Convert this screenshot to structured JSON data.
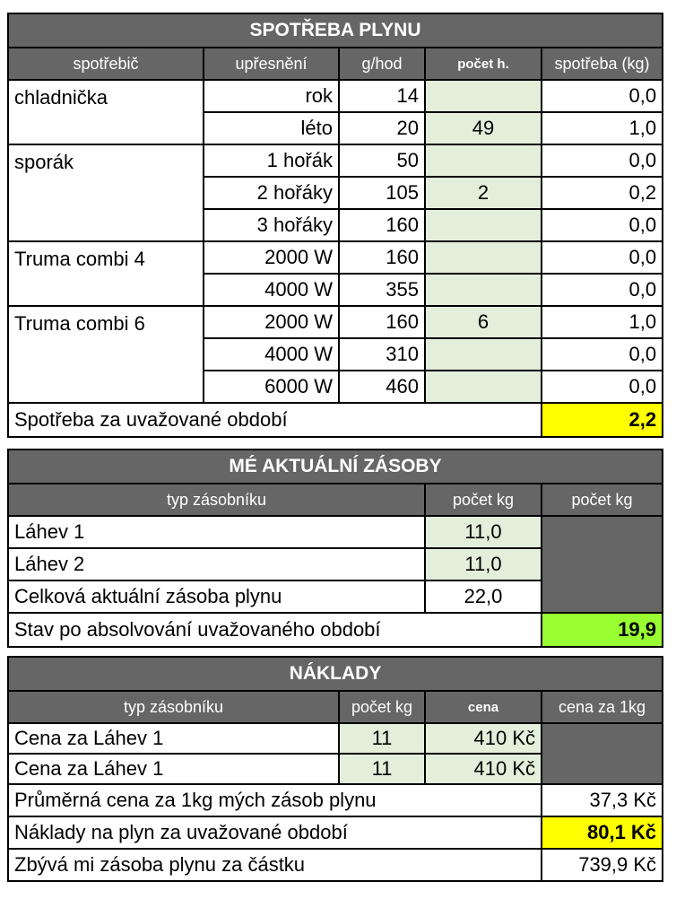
{
  "consumption": {
    "title": "SPOTŘEBA PLYNU",
    "headers": [
      "spotřebič",
      "upřesnění",
      "g/hod",
      "počet h.",
      "spotřeba (kg)"
    ],
    "groups": [
      {
        "appliance": "chladnička",
        "rows": [
          {
            "spec": "rok",
            "gph": "14",
            "hours": "",
            "kg": "0,0"
          },
          {
            "spec": "léto",
            "gph": "20",
            "hours": "49",
            "kg": "1,0"
          }
        ]
      },
      {
        "appliance": "sporák",
        "rows": [
          {
            "spec": "1 hořák",
            "gph": "50",
            "hours": "",
            "kg": "0,0"
          },
          {
            "spec": "2 hořáky",
            "gph": "105",
            "hours": "2",
            "kg": "0,2"
          },
          {
            "spec": "3 hořáky",
            "gph": "160",
            "hours": "",
            "kg": "0,0"
          }
        ]
      },
      {
        "appliance": "Truma combi 4",
        "rows": [
          {
            "spec": "2000 W",
            "gph": "160",
            "hours": "",
            "kg": "0,0"
          },
          {
            "spec": "4000 W",
            "gph": "355",
            "hours": "",
            "kg": "0,0"
          }
        ]
      },
      {
        "appliance": "Truma combi 6",
        "rows": [
          {
            "spec": "2000 W",
            "gph": "160",
            "hours": "6",
            "kg": "1,0"
          },
          {
            "spec": "4000 W",
            "gph": "310",
            "hours": "",
            "kg": "0,0"
          },
          {
            "spec": "6000 W",
            "gph": "460",
            "hours": "",
            "kg": "0,0"
          }
        ]
      }
    ],
    "total_label": "Spotřeba za uvažované období",
    "total_value": "2,2"
  },
  "stock": {
    "title": "MÉ AKTUÁLNÍ ZÁSOBY",
    "headers": [
      "typ zásobníku",
      "počet kg",
      "počet kg"
    ],
    "rows": [
      {
        "label": "Láhev 1",
        "kg": "11,0"
      },
      {
        "label": "Láhev 2",
        "kg": "11,0"
      },
      {
        "label": "Celková aktuální zásoba plynu",
        "kg": "22,0"
      }
    ],
    "after_label": "Stav po absolvování uvažovaného období",
    "after_value": "19,9"
  },
  "costs": {
    "title": "NÁKLADY",
    "headers": [
      "typ zásobníku",
      "počet kg",
      "cena",
      "cena za 1kg"
    ],
    "rows": [
      {
        "label": "Cena za Láhev 1",
        "kg": "11",
        "price": "410 Kč"
      },
      {
        "label": "Cena za Láhev 1",
        "kg": "11",
        "price": "410 Kč"
      }
    ],
    "avg_label": "Průměrná cena za 1kg mých zásob plynu",
    "avg_value": "37,3 Kč",
    "period_label": "Náklady na plyn za uvažované období",
    "period_value": "80,1 Kč",
    "remaining_label": "Zbývá mi zásoba plynu za částku",
    "remaining_value": "739,9 Kč"
  }
}
